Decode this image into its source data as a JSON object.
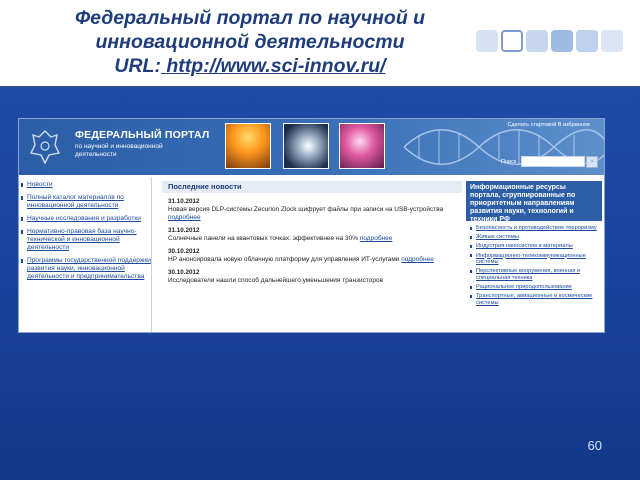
{
  "slide": {
    "title_line1": "Федеральный портал по научной и",
    "title_line2": "инновационной деятельности",
    "url_label": "URL:",
    "url": " http://www.sci-innov.ru/",
    "page_number": "60"
  },
  "portal": {
    "name": "ФЕДЕРАЛЬНЫЙ ПОРТАЛ",
    "subtitle": "по научной и инновационной деятельности",
    "top_link": "Сделать стартовой  В избранное",
    "search_label": "Поиск",
    "search_value": "",
    "search_button": "›",
    "left_nav": [
      "Новости",
      "Полный каталог материалов по инновационной деятельности",
      "Научные исследования и разработки",
      "Нормативно-правовая база научно-технической и инновационной деятельности",
      "Программы государственной поддержки развития науки, инновационной деятельности и предпринимательства"
    ],
    "news": {
      "heading": "Последние новости",
      "more_label": "подробнее",
      "items": [
        {
          "date": "31.10.2012",
          "text": "Новая версия DLP-системы Zecurion Zlock шифрует файлы при записи на USB-устройства"
        },
        {
          "date": "31.10.2012",
          "text": "Солнечные панели на квантовых точках: эффективнее на 30%"
        },
        {
          "date": "30.10.2012",
          "text": "HP анонсировала новую облачную платформу для управления ИТ-услугами"
        },
        {
          "date": "30.10.2012",
          "text": "Исследователи нашли способ дальнейшего уменьшения транзисторов"
        }
      ]
    },
    "resources": {
      "heading": "Информационные ресурсы портала, сгруппированные по приоритетным направлениям развития науки, технологий и техники РФ",
      "items": [
        "Безопасность и противодействие терроризму",
        "Живые системы",
        "Индустрия наносистем и материалы",
        "Информационно-телекоммуникационные системы",
        "Перспективные вооружения, военная и специальная техника",
        "Рациональное природопользование",
        "Транспортные, авиационные и космические системы"
      ]
    }
  },
  "colors": {
    "title": "#1f3d7a",
    "slide_body": "#1a45a0",
    "portal_header": "#2b5ea6",
    "link": "#1a4a9c"
  },
  "icons": [
    "emblem-icon",
    "dna-icon",
    "search-icon"
  ]
}
